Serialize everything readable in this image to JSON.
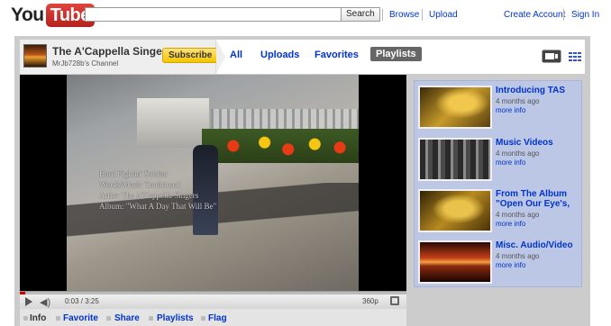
{
  "logo": {
    "you": "You",
    "tube": "Tube"
  },
  "search": {
    "placeholder": "",
    "value": "",
    "button": "Search"
  },
  "top_links": {
    "browse": "Browse",
    "upload": "Upload",
    "create_account": "Create Account",
    "sign_in": "Sign In"
  },
  "channel": {
    "title": "The A'Cappella Singers",
    "subtitle": "MrJb728b's Channel",
    "subscribe": "Subscribe",
    "tabs": [
      "All",
      "Uploads",
      "Favorites",
      "Playlists"
    ],
    "active_tab": "Playlists"
  },
  "video": {
    "overlay_lines": "Hard Fightin' Soldier\nWords/Music Traditional\nArtist: The A'Cappella Singers\nAlbum: \"What A Day That Will Be\"",
    "time": "0:03 / 3:25",
    "quality": "360p",
    "progress_fraction": 0.015
  },
  "info_bar": {
    "info": "Info",
    "favorite": "Favorite",
    "share": "Share",
    "playlists": "Playlists",
    "flag": "Flag"
  },
  "playlist": [
    {
      "title": "Introducing TAS",
      "age": "4 months ago",
      "more": "more info"
    },
    {
      "title": "Music Videos",
      "age": "4 months ago",
      "more": "more info"
    },
    {
      "title": "From The Album \"Open Our Eye's,",
      "age": "4 months ago",
      "more": "more info"
    },
    {
      "title": "Misc. Audio/Video",
      "age": "4 months ago",
      "more": "more info"
    }
  ],
  "colors": {
    "accent_link": "#0033cc",
    "subscribe": "#f4c400",
    "panel_bg": "#cccccc",
    "playlist_bg": "#bcc7e6",
    "progress": "#cc0000"
  }
}
